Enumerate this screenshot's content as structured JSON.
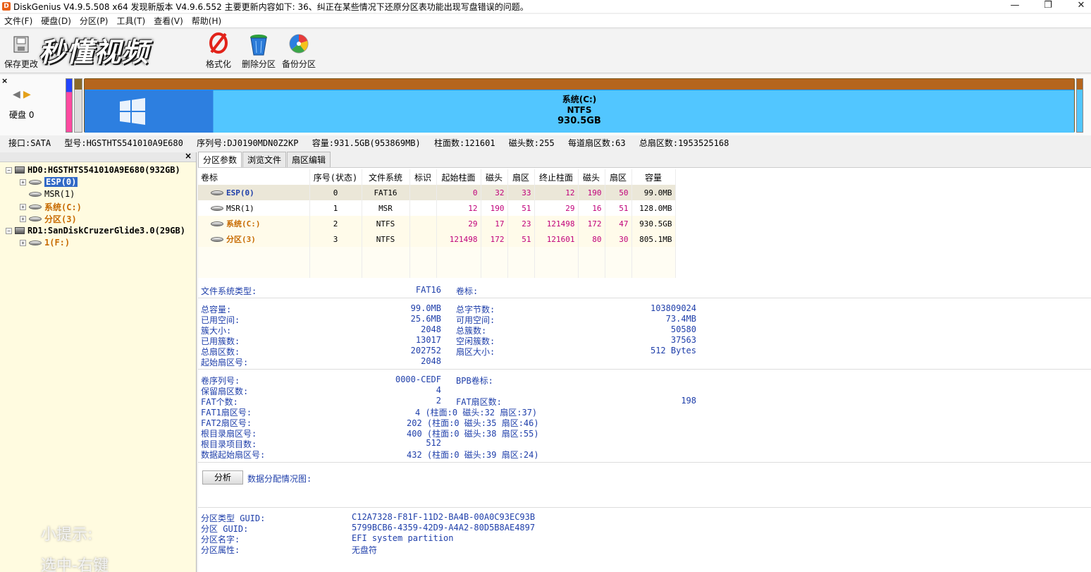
{
  "window": {
    "title": "DiskGenius V4.9.5.508 x64   发现新版本 V4.9.6.552 主要更新内容如下: 36、纠正在某些情况下还原分区表功能出现写盘错误的问题。",
    "minimize": "—",
    "restore": "❐",
    "close": "✕",
    "app_icon": "D"
  },
  "menu": [
    "文件(F)",
    "硬盘(D)",
    "分区(P)",
    "工具(T)",
    "查看(V)",
    "帮助(H)"
  ],
  "toolbar": {
    "save": "保存更改",
    "format": "格式化",
    "delete": "删除分区",
    "backup": "备份分区",
    "watermark": "秒懂视频"
  },
  "diskbar": {
    "close": "×",
    "disk_label": "硬盘 0",
    "nav_left": "◀",
    "nav_right": "▶",
    "main_partition": {
      "name": "系统(C:)",
      "fs": "NTFS",
      "size": "930.5GB"
    }
  },
  "disk_info": {
    "interface": "接口:SATA",
    "model": "型号:HGSTHTS541010A9E680",
    "serial": "序列号:DJ0190MDN0Z2KP",
    "capacity": "容量:931.5GB(953869MB)",
    "cylinders": "柱面数:121601",
    "heads": "磁头数:255",
    "sectors_per_track": "每道扇区数:63",
    "total_sectors": "总扇区数:1953525168"
  },
  "tree": {
    "close": "×",
    "hd0": "HD0:HGSTHTS541010A9E680(932GB)",
    "hd0_parts": [
      "ESP(0)",
      "MSR(1)",
      "系统(C:)",
      "分区(3)"
    ],
    "rd1": "RD1:SanDiskCruzerGlide3.0(29GB)",
    "rd1_parts": [
      "1(F:)"
    ],
    "tip_line1": "小提示:",
    "tip_line2": "选中-右键"
  },
  "tabs": [
    "分区参数",
    "浏览文件",
    "扇区编辑"
  ],
  "partition_table": {
    "headers": [
      "卷标",
      "序号(状态)",
      "文件系统",
      "标识",
      "起始柱面",
      "磁头",
      "扇区",
      "终止柱面",
      "磁头",
      "扇区",
      "容量"
    ],
    "rows": [
      {
        "label": "ESP(0)",
        "index": "0",
        "fs": "FAT16",
        "flag": "",
        "start_cyl": "0",
        "start_head": "32",
        "start_sec": "33",
        "end_cyl": "12",
        "end_head": "190",
        "end_sec": "50",
        "size": "99.0MB"
      },
      {
        "label": "MSR(1)",
        "index": "1",
        "fs": "MSR",
        "flag": "",
        "start_cyl": "12",
        "start_head": "190",
        "start_sec": "51",
        "end_cyl": "29",
        "end_head": "16",
        "end_sec": "51",
        "size": "128.0MB"
      },
      {
        "label": "系统(C:)",
        "index": "2",
        "fs": "NTFS",
        "flag": "",
        "start_cyl": "29",
        "start_head": "17",
        "start_sec": "23",
        "end_cyl": "121498",
        "end_head": "172",
        "end_sec": "47",
        "size": "930.5GB"
      },
      {
        "label": "分区(3)",
        "index": "3",
        "fs": "NTFS",
        "flag": "",
        "start_cyl": "121498",
        "start_head": "172",
        "start_sec": "51",
        "end_cyl": "121601",
        "end_head": "80",
        "end_sec": "30",
        "size": "805.1MB"
      }
    ]
  },
  "details": {
    "fs_type_label": "文件系统类型:",
    "fs_type_value": "FAT16",
    "volume_label": "卷标:",
    "total_capacity_label": "总容量:",
    "total_capacity_value": "99.0MB",
    "total_bytes_label": "总字节数:",
    "total_bytes_value": "103809024",
    "used_space_label": "已用空间:",
    "used_space_value": "25.6MB",
    "free_space_label": "可用空间:",
    "free_space_value": "73.4MB",
    "cluster_size_label": "簇大小:",
    "cluster_size_value": "2048",
    "total_clusters_label": "总簇数:",
    "total_clusters_value": "50580",
    "used_clusters_label": "已用簇数:",
    "used_clusters_value": "13017",
    "free_clusters_label": "空闲簇数:",
    "free_clusters_value": "37563",
    "total_sectors_label": "总扇区数:",
    "total_sectors_value": "202752",
    "sector_size_label": "扇区大小:",
    "sector_size_value": "512 Bytes",
    "start_sector_label": "起始扇区号:",
    "start_sector_value": "2048",
    "serial_label": "卷序列号:",
    "serial_value": "0000-CEDF",
    "bpb_label": "BPB卷标:",
    "reserved_label": "保留扇区数:",
    "reserved_value": "4",
    "fat_count_label": "FAT个数:",
    "fat_count_value": "2",
    "fat_sectors_label": "FAT扇区数:",
    "fat_sectors_value": "198",
    "fat1_label": "FAT1扇区号:",
    "fat1_value": "4 (柱面:0 磁头:32 扇区:37)",
    "fat2_label": "FAT2扇区号:",
    "fat2_value": "202 (柱面:0 磁头:35 扇区:46)",
    "root_label": "根目录扇区号:",
    "root_value": "400 (柱面:0 磁头:38 扇区:55)",
    "root_entries_label": "根目录项目数:",
    "root_entries_value": "512",
    "data_start_label": "数据起始扇区号:",
    "data_start_value": "432 (柱面:0 磁头:39 扇区:24)",
    "analyze_button": "分析",
    "alloc_label": "数据分配情况图:",
    "type_guid_label": "分区类型 GUID:",
    "type_guid_value": "C12A7328-F81F-11D2-BA4B-00A0C93EC93B",
    "guid_label": "分区 GUID:",
    "guid_value": "5799BCB6-4359-42D9-A4A2-80D5B8AE4897",
    "name_label": "分区名字:",
    "name_value": "EFI system partition",
    "attr_label": "分区属性:",
    "attr_value": "无盘符"
  }
}
